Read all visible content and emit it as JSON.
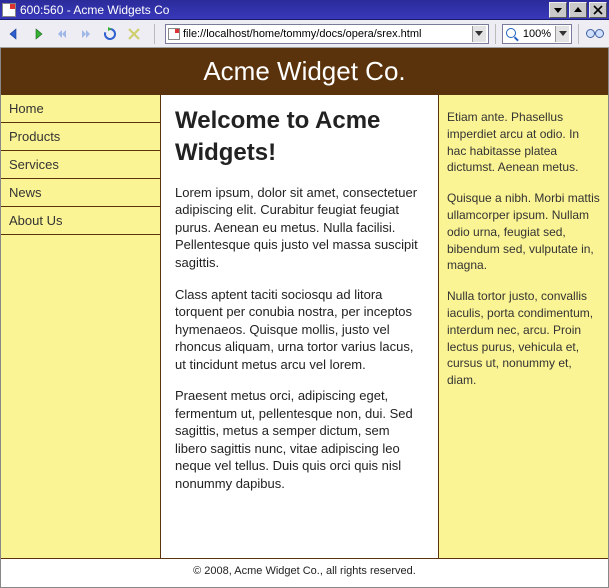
{
  "window": {
    "title": "600:560 - Acme Widgets Co",
    "buttons": {
      "min": "▾",
      "max": "▴",
      "close": "X"
    }
  },
  "toolbar": {
    "url": "file://localhost/home/tommy/docs/opera/srex.html",
    "zoom": "100%"
  },
  "icons": {
    "back": "back-icon",
    "forward": "forward-icon",
    "rewind": "rewind-icon",
    "fastfwd": "fastfwd-icon",
    "reload": "reload-icon"
  },
  "page": {
    "header": "Acme Widget Co.",
    "nav": {
      "items": [
        "Home",
        "Products",
        "Services",
        "News",
        "About Us"
      ]
    },
    "main": {
      "heading": "Welcome to Acme Widgets!",
      "paragraphs": [
        "Lorem ipsum, dolor sit amet, consectetuer adipiscing elit. Curabitur feugiat feugiat purus. Aenean eu metus. Nulla facilisi. Pellentesque quis justo vel massa suscipit sagittis.",
        "Class aptent taciti sociosqu ad litora torquent per conubia nostra, per inceptos hymenaeos. Quisque mollis, justo vel rhoncus aliquam, urna tortor varius lacus, ut tincidunt metus arcu vel lorem.",
        "Praesent metus orci, adipiscing eget, fermentum ut, pellentesque non, dui. Sed sagittis, metus a semper dictum, sem libero sagittis nunc, vitae adipiscing leo neque vel tellus. Duis quis orci quis nisl nonummy dapibus."
      ]
    },
    "aside": {
      "paragraphs": [
        "Etiam ante. Phasellus imperdiet arcu at odio. In hac habitasse platea dictumst. Aenean metus.",
        "Quisque a nibh. Morbi mattis ullamcorper ipsum. Nullam odio urna, feugiat sed, bibendum sed, vulputate in, magna.",
        "Nulla tortor justo, convallis iaculis, porta condimentum, interdum nec, arcu. Proin lectus purus, vehicula et, cursus ut, nonummy et, diam."
      ]
    },
    "footer": "© 2008, Acme Widget Co., all rights reserved."
  }
}
